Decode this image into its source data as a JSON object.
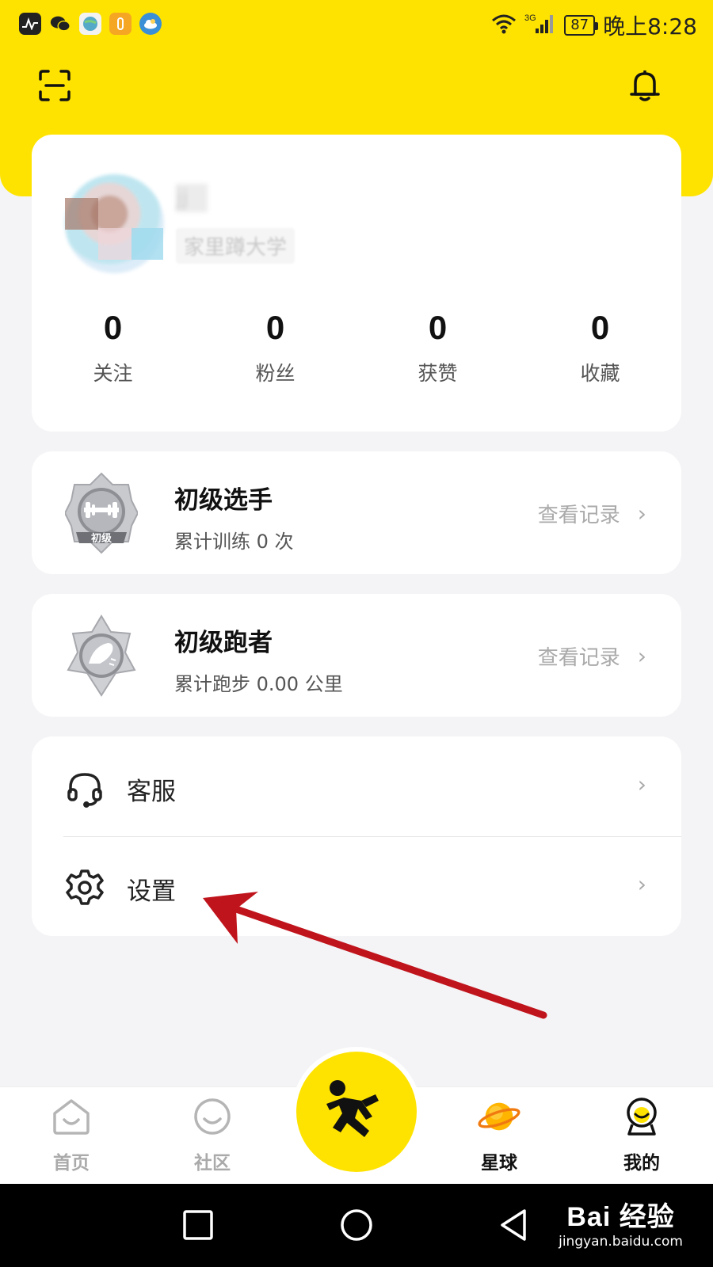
{
  "status_bar": {
    "time": "晚上8:28",
    "battery": "87",
    "network": "3G",
    "icons": [
      "activity-icon",
      "wechat-icon",
      "browser-icon",
      "app-icon",
      "weather-icon"
    ]
  },
  "header": {
    "scan_icon": "scan-icon",
    "bell_icon": "bell-icon"
  },
  "profile": {
    "name": "jj",
    "school": "家里蹲大学",
    "stats": [
      {
        "value": "0",
        "label": "关注"
      },
      {
        "value": "0",
        "label": "粉丝"
      },
      {
        "value": "0",
        "label": "获赞"
      },
      {
        "value": "0",
        "label": "收藏"
      }
    ]
  },
  "badges": [
    {
      "title": "初级选手",
      "subtitle": "累计训练 0 次",
      "link": "查看记录",
      "badge_text": "初级"
    },
    {
      "title": "初级跑者",
      "subtitle": "累计跑步 0.00 公里",
      "link": "查看记录"
    }
  ],
  "menu": [
    {
      "label": "客服",
      "icon": "headset-icon"
    },
    {
      "label": "设置",
      "icon": "gear-icon"
    }
  ],
  "tabbar": {
    "tabs": [
      {
        "label": "首页",
        "icon": "home-icon",
        "active": false
      },
      {
        "label": "社区",
        "icon": "smile-icon",
        "active": false
      },
      {
        "label": "星球",
        "icon": "planet-icon",
        "active": true
      },
      {
        "label": "我的",
        "icon": "profile-icon",
        "active": true
      }
    ],
    "center_icon": "running-man-icon"
  },
  "watermark": {
    "main": "Bai 经验",
    "sub": "jingyan.baidu.com"
  },
  "colors": {
    "accent": "#ffe300",
    "annotation": "#c0141c",
    "background": "#f4f4f6"
  }
}
